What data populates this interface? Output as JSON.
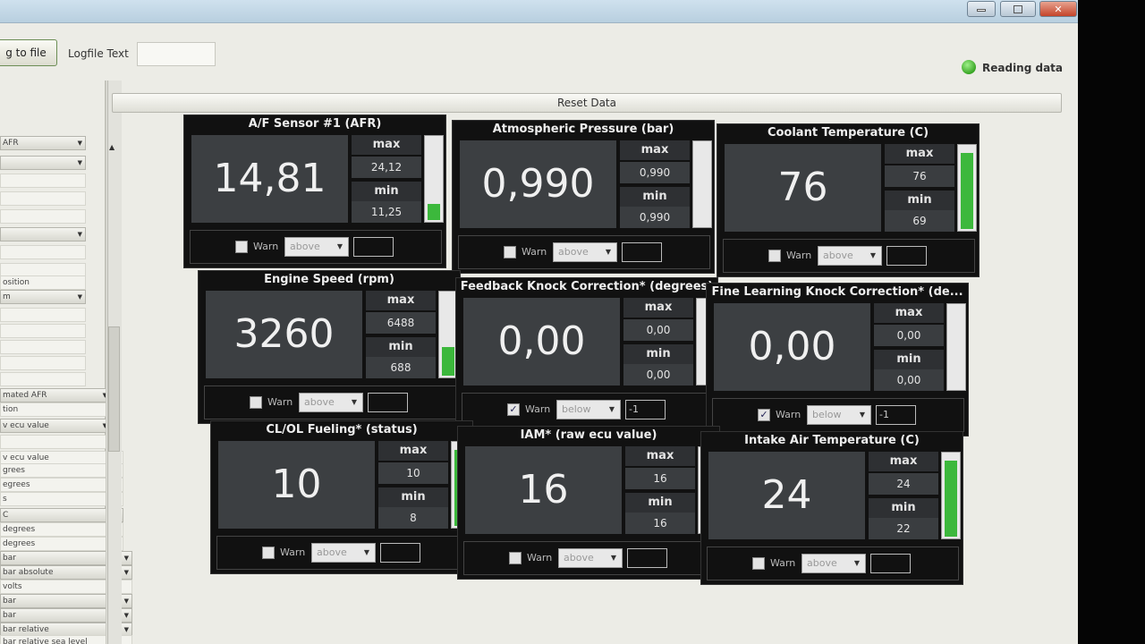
{
  "window": {
    "close_glyph": "✕"
  },
  "toolbar": {
    "log_button": "g to file",
    "logfile_label": "Logfile Text",
    "logfile_value": "",
    "status_text": "Reading data",
    "status_color": "#38a524"
  },
  "left": {
    "rows": [
      {
        "text": "AFR",
        "dropdown": true
      },
      {
        "text": "",
        "dropdown": true
      },
      {
        "text": "",
        "dropdown": false
      },
      {
        "text": "",
        "dropdown": false
      },
      {
        "text": "",
        "dropdown": false
      },
      {
        "text": "",
        "dropdown": true
      },
      {
        "text": "",
        "dropdown": false
      },
      {
        "text": "",
        "dropdown": false
      },
      {
        "text": "osition",
        "dropdown": false
      },
      {
        "text": "m",
        "dropdown": true
      },
      {
        "text": "",
        "dropdown": false
      },
      {
        "text": "",
        "dropdown": false
      },
      {
        "text": "",
        "dropdown": false
      },
      {
        "text": "",
        "dropdown": false
      },
      {
        "text": "",
        "dropdown": false
      },
      {
        "text": "mated AFR",
        "dropdown": true
      },
      {
        "text": "tion",
        "dropdown": false
      },
      {
        "text": "v ecu value",
        "dropdown": true
      },
      {
        "text": "",
        "dropdown": false
      },
      {
        "text": "v ecu value",
        "dropdown": false
      },
      {
        "text": "grees",
        "dropdown": false
      },
      {
        "text": "egrees",
        "dropdown": false
      },
      {
        "text": "s",
        "dropdown": false
      },
      {
        "text": "C",
        "dropdown": true
      },
      {
        "text": "degrees",
        "dropdown": false
      },
      {
        "text": "degrees",
        "dropdown": false
      },
      {
        "text": "bar",
        "dropdown": true
      },
      {
        "text": "bar absolute",
        "dropdown": true
      },
      {
        "text": "volts",
        "dropdown": false
      },
      {
        "text": "bar",
        "dropdown": true
      },
      {
        "text": "bar",
        "dropdown": true
      },
      {
        "text": "bar relative",
        "dropdown": true
      },
      {
        "text": "bar relative sea level",
        "dropdown": false
      }
    ]
  },
  "main": {
    "reset_label": "Reset Data",
    "warn_label": "Warn",
    "max_label": "max",
    "min_label": "min",
    "gauges": [
      {
        "title": "A/F Sensor #1 (AFR)",
        "value": "14,81",
        "max": "24,12",
        "min": "11,25",
        "level": 0.2,
        "warn_checked": false,
        "warn_mode": "above",
        "warn_value": ""
      },
      {
        "title": "Atmospheric Pressure (bar)",
        "value": "0,990",
        "max": "0,990",
        "min": "0,990",
        "level": 0.0,
        "warn_checked": false,
        "warn_mode": "above",
        "warn_value": ""
      },
      {
        "title": "Coolant Temperature (C)",
        "value": "76",
        "max": "76",
        "min": "69",
        "level": 0.92,
        "warn_checked": false,
        "warn_mode": "above",
        "warn_value": ""
      },
      {
        "title": "Engine Speed (rpm)",
        "value": "3260",
        "max": "6488",
        "min": "688",
        "level": 0.35,
        "warn_checked": false,
        "warn_mode": "above",
        "warn_value": ""
      },
      {
        "title": "Feedback Knock Correction* (degrees)",
        "value": "0,00",
        "max": "0,00",
        "min": "0,00",
        "level": 0.0,
        "warn_checked": true,
        "warn_mode": "below",
        "warn_value": "-1"
      },
      {
        "title": "Fine Learning Knock Correction* (de...",
        "value": "0,00",
        "max": "0,00",
        "min": "0,00",
        "level": 0.0,
        "warn_checked": true,
        "warn_mode": "below",
        "warn_value": "-1"
      },
      {
        "title": "CL/OL Fueling* (status)",
        "value": "10",
        "max": "10",
        "min": "8",
        "level": 0.92,
        "warn_checked": false,
        "warn_mode": "above",
        "warn_value": ""
      },
      {
        "title": "IAM* (raw ecu value)",
        "value": "16",
        "max": "16",
        "min": "16",
        "level": 0.0,
        "warn_checked": false,
        "warn_mode": "above",
        "warn_value": ""
      },
      {
        "title": "Intake Air Temperature (C)",
        "value": "24",
        "max": "24",
        "min": "22",
        "level": 0.92,
        "warn_checked": false,
        "warn_mode": "above",
        "warn_value": ""
      }
    ]
  }
}
